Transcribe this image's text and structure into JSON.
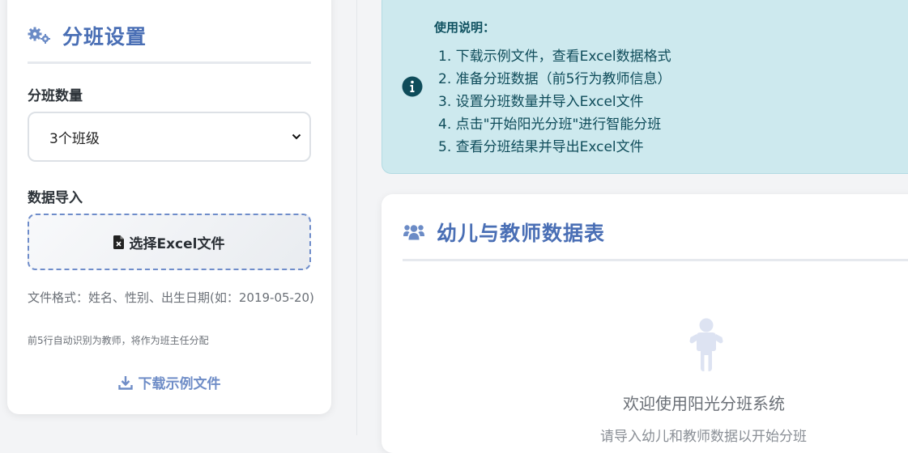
{
  "settings": {
    "title": "分班设置",
    "class_count_label": "分班数量",
    "class_count_value": "3个班级",
    "import_label": "数据导入",
    "file_button_label": "选择Excel文件",
    "format_hint": "文件格式：姓名、性别、出生日期(如：2019-05-20)",
    "teacher_hint": "前5行自动识别为教师，将作为班主任分配",
    "download_label": "下载示例文件"
  },
  "instructions": {
    "title": "使用说明：",
    "steps": [
      "1. 下载示例文件，查看Excel数据格式",
      "2. 准备分班数据（前5行为教师信息）",
      "3. 设置分班数量并导入Excel文件",
      "4. 点击\"开始阳光分班\"进行智能分班",
      "5. 查看分班结果并导出Excel文件"
    ]
  },
  "data_table": {
    "title": "幼儿与教师数据表",
    "empty_title": "欢迎使用阳光分班系统",
    "empty_subtitle": "请导入幼儿和教师数据以开始分班"
  },
  "icons": {
    "settings": "gears-icon",
    "file": "file-excel-icon",
    "download": "download-icon",
    "info": "info-circle-icon",
    "users": "users-icon",
    "empty": "child-icon"
  },
  "colors": {
    "accent": "#4a6fb5",
    "link": "#6f8dc7",
    "info_bg": "#cde9ee",
    "info_text": "#0f4c5a"
  }
}
